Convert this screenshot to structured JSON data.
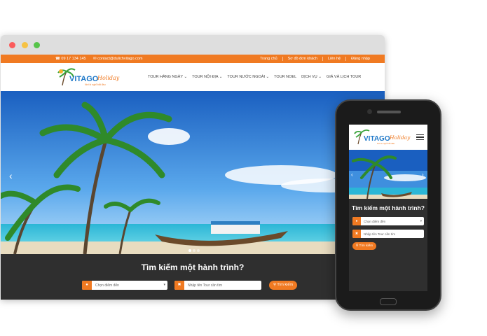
{
  "site": {
    "brand": "VITAGO",
    "brand_script": "Holiday",
    "tagline": "Nơi kì nghỉ bắt đầu",
    "phone": "09 17 134 145",
    "email": "contact@dulichvitago.com",
    "top_links": [
      "Trang chủ",
      "Sơ đồ đơn khách",
      "Liên hệ",
      "Đăng nhập"
    ],
    "menu": [
      "TOUR HÀNG NGÀY",
      "TOUR NỘI ĐỊA",
      "TOUR NƯỚC NGOÀI",
      "TOUR NOEL",
      "DỊCH VỤ",
      "GIÁ VÀ LỊCH TOUR"
    ]
  },
  "search": {
    "title": "Tìm kiếm một hành trình?",
    "destination_placeholder": "Chọn điểm đến",
    "tour_placeholder": "Nhập tên Tour cần tìm",
    "button": "Tìm kiếm"
  },
  "colors": {
    "accent": "#f07a22",
    "dark": "#2f2f2f"
  },
  "icons": [
    "phone-icon",
    "mail-icon",
    "location-icon",
    "cross-icon",
    "search-icon",
    "hamburger-icon",
    "chevron-left-icon",
    "chevron-right-icon",
    "chevron-down-icon"
  ]
}
